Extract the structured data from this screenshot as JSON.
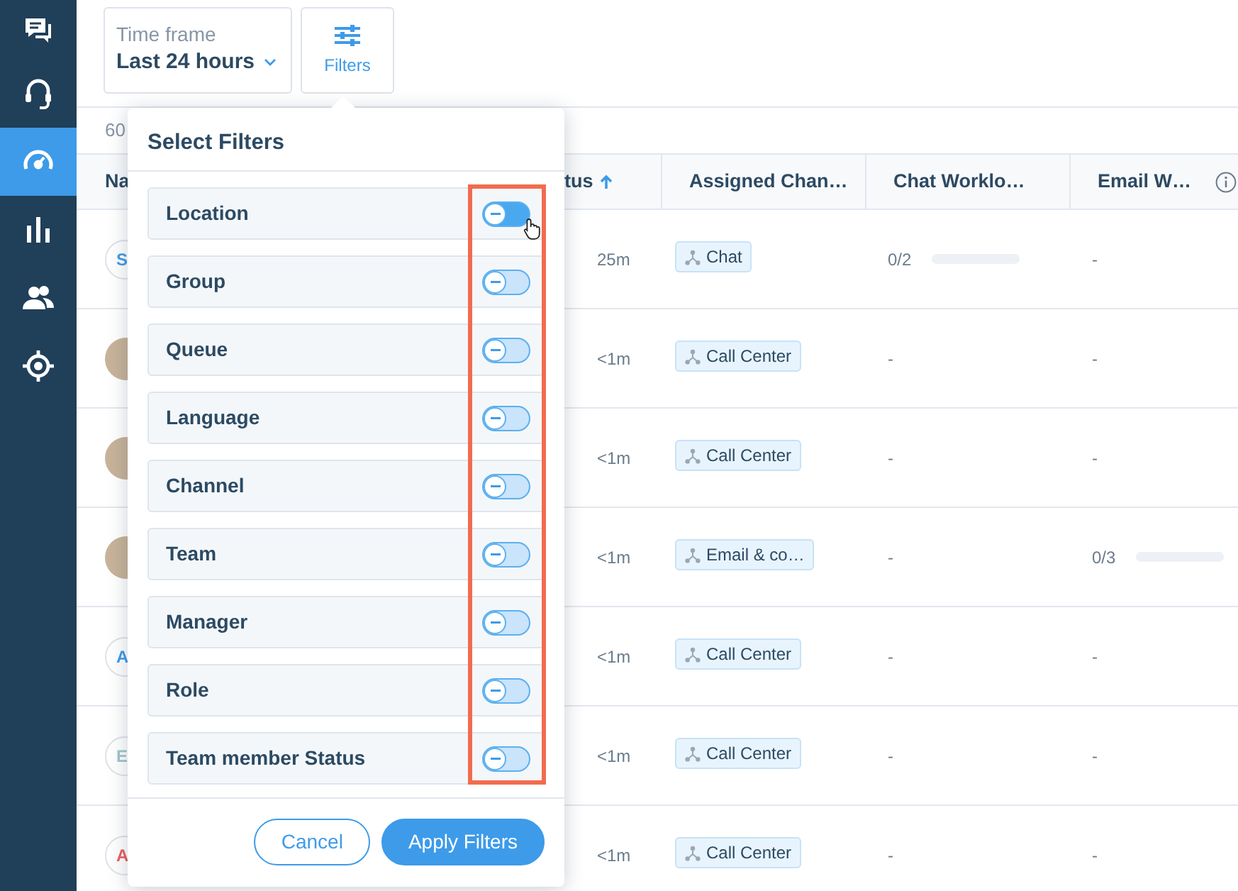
{
  "sidebar": {
    "items": [
      {
        "selected": false
      },
      {
        "selected": false
      },
      {
        "selected": true
      },
      {
        "selected": false
      },
      {
        "selected": false
      },
      {
        "selected": false
      }
    ]
  },
  "toolbar": {
    "time_frame": {
      "label": "Time frame",
      "value": "Last 24 hours"
    },
    "filters_button": {
      "label": "Filters"
    }
  },
  "table": {
    "count": "60",
    "columns": [
      {
        "label": "Na"
      },
      {
        "label": "tus",
        "sorted": true
      },
      {
        "label": "Assigned Chan…"
      },
      {
        "label": "Chat Worklo…"
      },
      {
        "label": "Email W…",
        "info": true
      }
    ],
    "rows": [
      {
        "avatar": {
          "kind": "initial",
          "text": "S",
          "color": "#3d9be9"
        },
        "status": "25m",
        "channel": "Chat",
        "chat_workload": {
          "reading": "0/2",
          "level": 0
        },
        "email_workload": {
          "reading": "-"
        }
      },
      {
        "avatar": {
          "kind": "photo"
        },
        "status": "<1m",
        "channel": "Call Center",
        "chat_workload": {
          "reading": "-"
        },
        "email_workload": {
          "reading": "-"
        }
      },
      {
        "avatar": {
          "kind": "photo"
        },
        "status": "<1m",
        "channel": "Call Center",
        "chat_workload": {
          "reading": "-"
        },
        "email_workload": {
          "reading": "-"
        }
      },
      {
        "avatar": {
          "kind": "photo"
        },
        "status": "<1m",
        "channel": "Email & co…",
        "chat_workload": {
          "reading": "-"
        },
        "email_workload": {
          "reading": "0/3",
          "level": 0
        }
      },
      {
        "avatar": {
          "kind": "initial",
          "text": "A",
          "color": "#3d9be9"
        },
        "status": "<1m",
        "channel": "Call Center",
        "chat_workload": {
          "reading": "-"
        },
        "email_workload": {
          "reading": "-"
        }
      },
      {
        "avatar": {
          "kind": "initial",
          "text": "E",
          "color": "#9fc7c9"
        },
        "status": "<1m",
        "channel": "Call Center",
        "chat_workload": {
          "reading": "-"
        },
        "email_workload": {
          "reading": "-"
        }
      },
      {
        "avatar": {
          "kind": "initial",
          "text": "A",
          "color": "#f05b5b"
        },
        "status": "<1m",
        "channel": "Call Center",
        "chat_workload": {
          "reading": "-"
        },
        "email_workload": {
          "reading": "-"
        }
      }
    ]
  },
  "filter_popover": {
    "title": "Select Filters",
    "highlight_frame": true,
    "filters": [
      {
        "label": "Location",
        "on": false,
        "hovered": true
      },
      {
        "label": "Group",
        "on": false
      },
      {
        "label": "Queue",
        "on": false
      },
      {
        "label": "Language",
        "on": false
      },
      {
        "label": "Channel",
        "on": false
      },
      {
        "label": "Team",
        "on": false
      },
      {
        "label": "Manager",
        "on": false
      },
      {
        "label": "Role",
        "on": false
      },
      {
        "label": "Team member Status",
        "on": false
      }
    ],
    "buttons": {
      "cancel": "Cancel",
      "apply": "Apply Filters"
    }
  }
}
